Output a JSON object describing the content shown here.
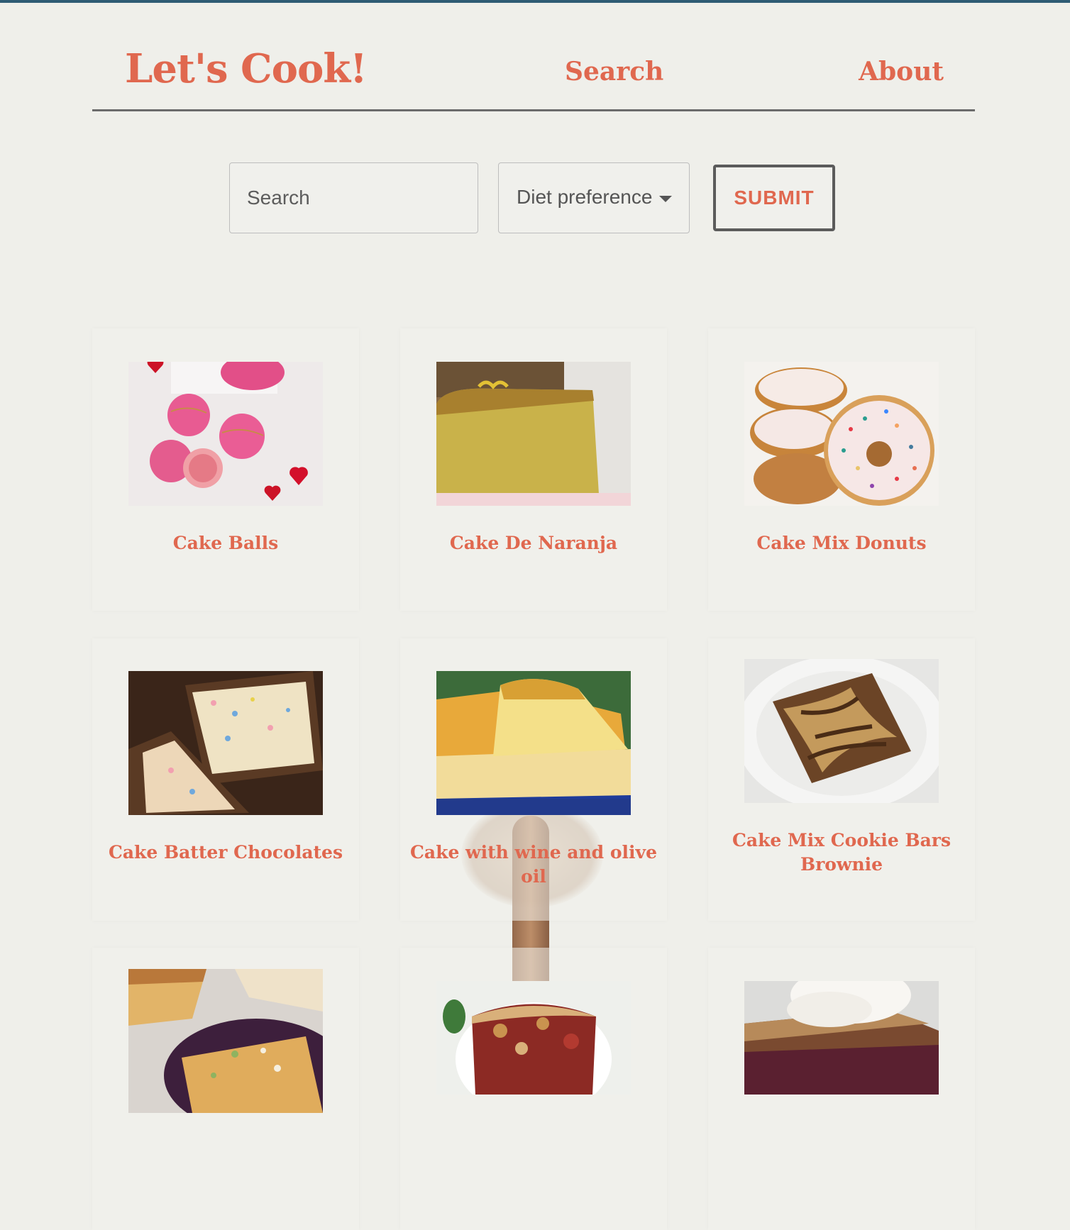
{
  "header": {
    "logo": "Let's Cook!",
    "nav": {
      "search": "Search",
      "about": "About"
    }
  },
  "search_form": {
    "search_placeholder": "Search",
    "diet_label": "Diet preference",
    "submit_label": "SUBMIT"
  },
  "colors": {
    "accent": "#e0684f",
    "background": "#efefea",
    "top_strip": "#2f5c74",
    "border": "#6b6b6b"
  },
  "recipes": [
    {
      "title": "Cake Balls",
      "image": "pink-cake-pops-photo"
    },
    {
      "title": "Cake De Naranja",
      "image": "orange-loaf-cake-photo"
    },
    {
      "title": "Cake Mix Donuts",
      "image": "sprinkle-donuts-photo"
    },
    {
      "title": "Cake Batter Chocolates",
      "image": "chocolate-covered-batter-photo"
    },
    {
      "title": "Cake with wine and olive oil",
      "image": "yellow-sponge-cake-photo"
    },
    {
      "title": "Cake Mix Cookie Bars Brownie",
      "image": "marbled-brownie-bar-photo"
    },
    {
      "title": "",
      "image": "pistachio-cake-photo"
    },
    {
      "title": "",
      "image": "fruit-cobbler-photo"
    },
    {
      "title": "",
      "image": "cake-with-cream-photo"
    }
  ]
}
